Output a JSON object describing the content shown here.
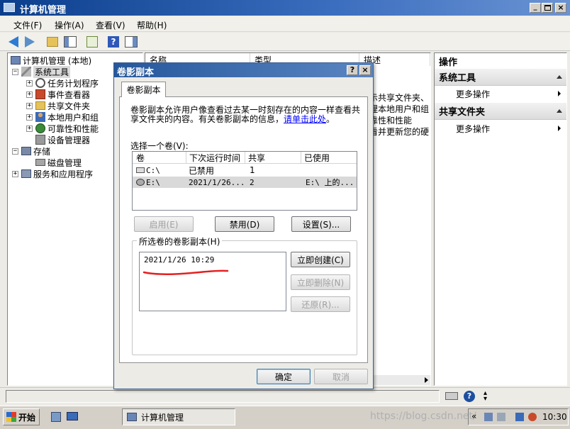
{
  "window": {
    "title": "计算机管理"
  },
  "menu": [
    "文件(F)",
    "操作(A)",
    "查看(V)",
    "帮助(H)"
  ],
  "tree": {
    "root": "计算机管理 (本地)",
    "system_tools": "系统工具",
    "children": [
      "任务计划程序",
      "事件查看器",
      "共享文件夹",
      "本地用户和组",
      "可靠性和性能",
      "设备管理器"
    ],
    "storage": "存储",
    "disk_mgmt": "磁盘管理",
    "services": "服务和应用程序"
  },
  "list_headers": [
    "名称",
    "类型",
    "描述"
  ],
  "list_desc_fragments": [
    "示共享文件夹、",
    "理本地用户和组",
    "靠性和性能",
    "看并更新您的硬"
  ],
  "actions": {
    "title": "操作",
    "sections": [
      {
        "header": "系统工具",
        "item": "更多操作"
      },
      {
        "header": "共享文件夹",
        "item": "更多操作"
      }
    ]
  },
  "dialog": {
    "title": "卷影副本",
    "help_btn": "?",
    "close_btn": "×",
    "tab": "卷影副本",
    "description": "卷影副本允许用户像查看过去某一时刻存在的内容一样查看共享文件夹的内容。有关卷影副本的信息，",
    "link": "请单击此处",
    "desc_end": "。",
    "select_label": "选择一个卷(V):",
    "columns": [
      "卷",
      "下次运行时间",
      "共享",
      "已使用"
    ],
    "volumes": [
      {
        "vol": "C:\\",
        "next": "已禁用",
        "shares": "1",
        "used": ""
      },
      {
        "vol": "E:\\",
        "next": "2021/1/26...",
        "shares": "2",
        "used": "E:\\ 上的..."
      }
    ],
    "enable_btn": "启用(E)",
    "disable_btn": "禁用(D)",
    "settings_btn": "设置(S)...",
    "group_label": "所选卷的卷影副本(H)",
    "copies": [
      "2021/1/26 10:29"
    ],
    "create_btn": "立即创建(C)",
    "delete_btn": "立即删除(N)",
    "restore_btn": "还原(R)...",
    "ok_btn": "确定",
    "cancel_btn": "取消"
  },
  "taskbar": {
    "start": "开始",
    "task": "计算机管理",
    "watermark": "https://blog.csdn.net/",
    "clock": "10:30",
    "tray_arrow": "«"
  },
  "colors": {
    "titlebar": "#1d4fa0",
    "dialog_title": "#26579b",
    "link": "#0000ff",
    "red_mark": "#e52020"
  }
}
